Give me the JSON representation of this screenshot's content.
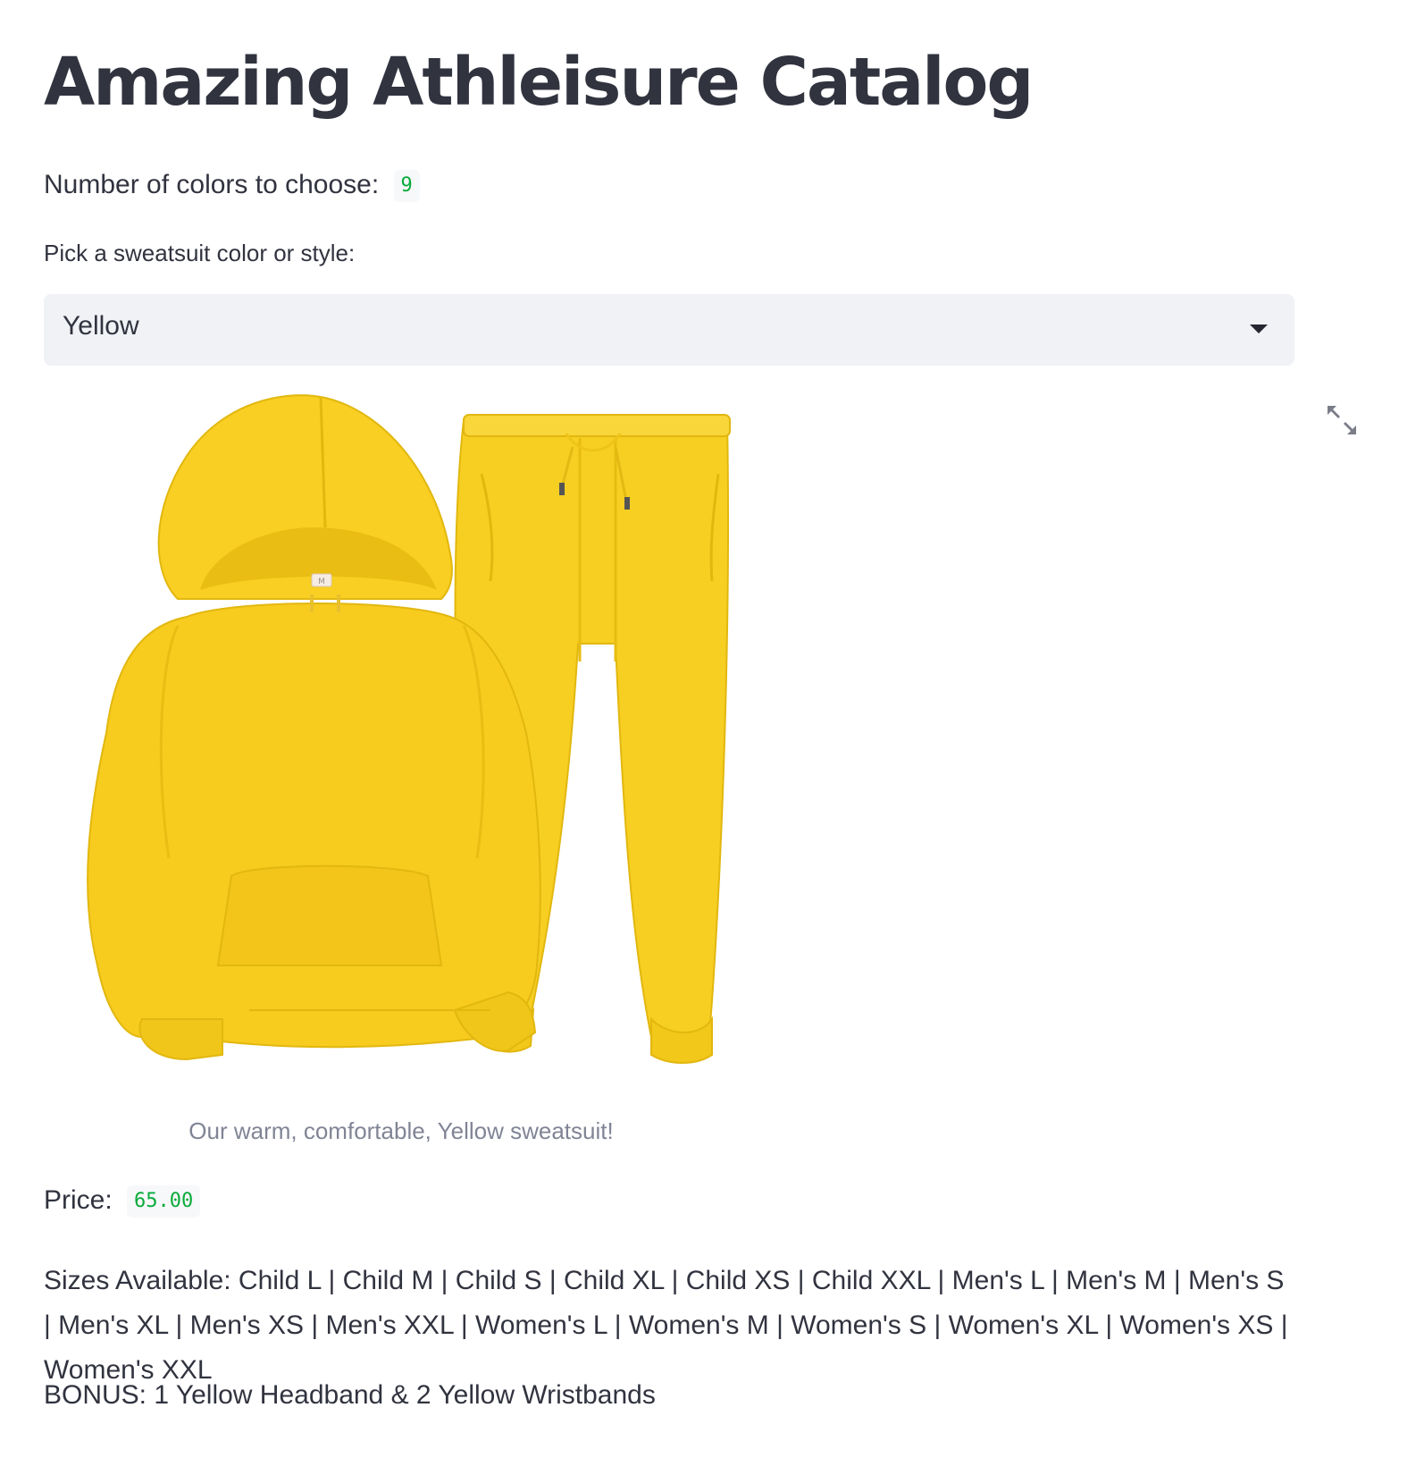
{
  "app": {
    "title": "Amazing Athleisure Catalog"
  },
  "colors_count": {
    "label": "Number of colors to choose:",
    "value": "9"
  },
  "selector": {
    "label": "Pick a sweatsuit color or style:",
    "selected": "Yellow"
  },
  "product_image": {
    "caption": "Our warm, comfortable, Yellow sweatsuit!",
    "tag_text": "M",
    "garment_color": "#f9cf1b",
    "expand_icon": "fullscreen-icon"
  },
  "price": {
    "label": "Price:",
    "value": "65.00"
  },
  "sizes": {
    "text": "Sizes Available: Child L | Child M | Child S | Child XL | Child XS | Child XXL | Men's L | Men's M | Men's S | Men's XL | Men's XS | Men's XXL | Women's L | Women's M | Women's S | Women's XL | Women's XS | Women's XXL"
  },
  "bonus": {
    "text": "BONUS: 1 Yellow Headband & 2 Yellow Wristbands"
  }
}
